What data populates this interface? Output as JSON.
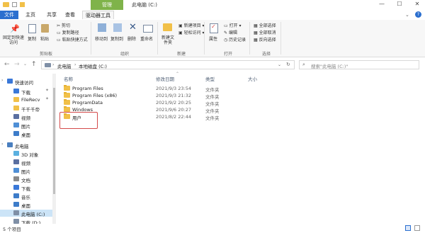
{
  "window": {
    "title": "此电脑 (C:)",
    "manage_tab": "管理",
    "controls": {
      "minimize": "—",
      "maximize": "☐",
      "close": "✕"
    }
  },
  "ribbon_tabs": [
    "文件",
    "主页",
    "共享",
    "查看",
    "驱动器工具"
  ],
  "ribbon": {
    "clipboard": {
      "pin": "固定到快速访问",
      "copy": "复制",
      "paste": "粘贴",
      "cut": "剪切",
      "copy_path": "复制路径",
      "paste_shortcut": "粘贴快捷方式",
      "label": "剪贴板"
    },
    "organize": {
      "move_to": "移动到",
      "copy_to": "复制到",
      "delete": "删除",
      "rename": "重命名",
      "label": "组织"
    },
    "new": {
      "new_folder": "新建文件夹",
      "new_item": "新建项目 ▾",
      "easy_access": "轻松访问 ▾",
      "label": "新建"
    },
    "open": {
      "properties": "属性",
      "open": "打开 ▾",
      "edit": "编辑",
      "history": "历史记录",
      "label": "打开"
    },
    "select": {
      "select_all": "全部选择",
      "select_none": "全部取消",
      "invert": "反向选择",
      "label": "选择"
    }
  },
  "address": {
    "path": [
      "此电脑",
      "本地磁盘 (C:)"
    ],
    "search_placeholder": "搜索\"此电脑 (C:)\""
  },
  "sidebar": {
    "items": [
      {
        "label": "快速访问",
        "icon": "star-icon",
        "color": "#3a78d8"
      },
      {
        "label": "下载",
        "icon": "download-icon",
        "color": "#3a78d8"
      },
      {
        "label": "FileRecv",
        "icon": "folder-icon",
        "color": "#f1c048"
      },
      {
        "label": "千千千帝",
        "icon": "folder-icon",
        "color": "#f1c048"
      },
      {
        "label": "视频",
        "icon": "video-icon",
        "color": "#5a6fa0"
      },
      {
        "label": "图片",
        "icon": "picture-icon",
        "color": "#4f8fd6"
      },
      {
        "label": "桌面",
        "icon": "desktop-icon",
        "color": "#3d7cc9"
      },
      {
        "label": "此电脑",
        "icon": "computer-icon",
        "color": "#4a7fbf"
      },
      {
        "label": "3D 对象",
        "icon": "3d-object-icon",
        "color": "#5ab0e0"
      },
      {
        "label": "视频",
        "icon": "video-icon",
        "color": "#5a6fa0"
      },
      {
        "label": "图片",
        "icon": "picture-icon",
        "color": "#4f8fd6"
      },
      {
        "label": "文档",
        "icon": "document-icon",
        "color": "#8a8a8a"
      },
      {
        "label": "下载",
        "icon": "download-icon",
        "color": "#3a78d8"
      },
      {
        "label": "音乐",
        "icon": "music-icon",
        "color": "#3d7cc9"
      },
      {
        "label": "桌面",
        "icon": "desktop-icon",
        "color": "#3d7cc9"
      },
      {
        "label": "此电脑 (C:)",
        "icon": "drive-icon",
        "color": "#7f8fa6"
      },
      {
        "label": "下载 (D:)",
        "icon": "drive-icon",
        "color": "#7f8fa6"
      }
    ]
  },
  "columns": {
    "name": "名称",
    "date": "修改日期",
    "type": "类型",
    "size": "大小"
  },
  "files": [
    {
      "name": "Program Files",
      "date": "2021/9/3 23:54",
      "type": "文件夹"
    },
    {
      "name": "Program Files (x86)",
      "date": "2021/9/3 21:32",
      "type": "文件夹"
    },
    {
      "name": "ProgramData",
      "date": "2021/9/2 20:25",
      "type": "文件夹"
    },
    {
      "name": "Windows",
      "date": "2021/9/6 20:27",
      "type": "文件夹"
    },
    {
      "name": "用户",
      "date": "2021/8/2 22:44",
      "type": "文件夹"
    }
  ],
  "status": {
    "count": "5 个项目"
  },
  "colors": {
    "accent": "#2b6fcf",
    "manage_tab": "#7fb34a",
    "highlight_box": "#d44a4a"
  }
}
